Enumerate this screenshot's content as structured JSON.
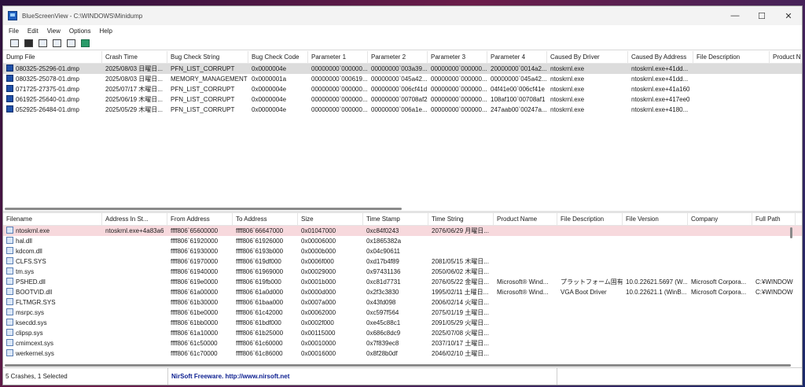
{
  "window": {
    "title": "BlueScreenView  -  C:\\WINDOWS\\Minidump",
    "minimize": "—",
    "maximize": "☐",
    "close": "✕"
  },
  "menu": [
    "File",
    "Edit",
    "View",
    "Options",
    "Help"
  ],
  "toolbar": [
    "properties-icon",
    "save-icon",
    "copy-icon",
    "html-report-icon",
    "find-icon",
    "exit-icon"
  ],
  "top_table": {
    "columns": [
      "Dump File",
      "Crash Time",
      "Bug Check String",
      "Bug Check Code",
      "Parameter 1",
      "Parameter 2",
      "Parameter 3",
      "Parameter 4",
      "Caused By Driver",
      "Caused By Address",
      "File Description",
      "Product N"
    ],
    "sort_indicator": "▽",
    "rows": [
      [
        "080325-25296-01.dmp",
        "2025/08/03 日曜日...",
        "PFN_LIST_CORRUPT",
        "0x0000004e",
        "00000000`000000...",
        "00000000`003a39...",
        "00000000`000000...",
        "20000000`0014a2...",
        "ntoskrnl.exe",
        "ntoskrnl.exe+41dd...",
        "",
        ""
      ],
      [
        "080325-25078-01.dmp",
        "2025/08/03 日曜日...",
        "MEMORY_MANAGEMENT",
        "0x0000001a",
        "00000000`000619...",
        "00000000`045a42...",
        "00000000`000000...",
        "00000000`045a42...",
        "ntoskrnl.exe",
        "ntoskrnl.exe+41dd...",
        "",
        ""
      ],
      [
        "071725-27375-01.dmp",
        "2025/07/17 木曜日...",
        "PFN_LIST_CORRUPT",
        "0x0000004e",
        "00000000`000000...",
        "00000000`006cf41d",
        "00000000`000000...",
        "04f41e00`006cf41e",
        "ntoskrnl.exe",
        "ntoskrnl.exe+41a160",
        "",
        ""
      ],
      [
        "061925-25640-01.dmp",
        "2025/06/19 木曜日...",
        "PFN_LIST_CORRUPT",
        "0x0000004e",
        "00000000`000000...",
        "00000000`00708af2",
        "00000000`000000...",
        "108af100`00708af1",
        "ntoskrnl.exe",
        "ntoskrnl.exe+417ee0",
        "",
        ""
      ],
      [
        "052925-26484-01.dmp",
        "2025/05/29 木曜日...",
        "PFN_LIST_CORRUPT",
        "0x0000004e",
        "00000000`000000...",
        "00000000`006a1e...",
        "00000000`000000...",
        "247aab00`00247a...",
        "ntoskrnl.exe",
        "ntoskrnl.exe+4180...",
        "",
        ""
      ]
    ]
  },
  "bottom_table": {
    "columns": [
      "Filename",
      "Address In St...",
      "From Address",
      "To Address",
      "Size",
      "Time Stamp",
      "Time String",
      "Product Name",
      "File Description",
      "File Version",
      "Company",
      "Full Path"
    ],
    "sort_indicator": "/",
    "rows": [
      [
        "ntoskrnl.exe",
        "ntoskrnl.exe+4a83a6",
        "ffff806`65600000",
        "ffff806`66647000",
        "0x01047000",
        "0xc84f0243",
        "2076/06/29 月曜日...",
        "",
        "",
        "",
        "",
        ""
      ],
      [
        "hal.dll",
        "",
        "ffff806`61920000",
        "ffff806`61926000",
        "0x00006000",
        "0x1865382a",
        "",
        "",
        "",
        "",
        "",
        ""
      ],
      [
        "kdcom.dll",
        "",
        "ffff806`61930000",
        "ffff806`6193b000",
        "0x0000b000",
        "0x04c90611",
        "",
        "",
        "",
        "",
        "",
        ""
      ],
      [
        "CLFS.SYS",
        "",
        "ffff806`61970000",
        "ffff806`619df000",
        "0x0006f000",
        "0xd17b4f89",
        "2081/05/15 木曜日...",
        "",
        "",
        "",
        "",
        ""
      ],
      [
        "tm.sys",
        "",
        "ffff806`61940000",
        "ffff806`61969000",
        "0x00029000",
        "0x97431136",
        "2050/06/02 木曜日...",
        "",
        "",
        "",
        "",
        ""
      ],
      [
        "PSHED.dll",
        "",
        "ffff806`619e0000",
        "ffff806`619fb000",
        "0x0001b000",
        "0xc81d7731",
        "2076/05/22 金曜日...",
        "Microsoft® Wind...",
        "プラットフォーム固有...",
        "10.0.22621.5697 (W...",
        "Microsoft Corpora...",
        "C:¥WINDOW"
      ],
      [
        "BOOTVID.dll",
        "",
        "ffff806`61a00000",
        "ffff806`61a0d000",
        "0x0000d000",
        "0x2f3c3830",
        "1995/02/11 土曜日...",
        "Microsoft® Wind...",
        "VGA Boot Driver",
        "10.0.22621.1 (WinB...",
        "Microsoft Corpora...",
        "C:¥WINDOW"
      ],
      [
        "FLTMGR.SYS",
        "",
        "ffff806`61b30000",
        "ffff806`61baa000",
        "0x0007a000",
        "0x43fd098",
        "2006/02/14 火曜日...",
        "",
        "",
        "",
        "",
        ""
      ],
      [
        "msrpc.sys",
        "",
        "ffff806`61be0000",
        "ffff806`61c42000",
        "0x00062000",
        "0xc597f564",
        "2075/01/19 土曜日...",
        "",
        "",
        "",
        "",
        ""
      ],
      [
        "ksecdd.sys",
        "",
        "ffff806`61bb0000",
        "ffff806`61bdf000",
        "0x0002f000",
        "0xe45c88c1",
        "2091/05/29 火曜日...",
        "",
        "",
        "",
        "",
        ""
      ],
      [
        "clipsp.sys",
        "",
        "ffff806`61a10000",
        "ffff806`61b25000",
        "0x00115000",
        "0x686c8dc9",
        "2025/07/08 火曜日...",
        "",
        "",
        "",
        "",
        ""
      ],
      [
        "cmimcext.sys",
        "",
        "ffff806`61c50000",
        "ffff806`61c60000",
        "0x00010000",
        "0x7f839ec8",
        "2037/10/17 土曜日...",
        "",
        "",
        "",
        "",
        ""
      ],
      [
        "werkernel.sys",
        "",
        "ffff806`61c70000",
        "ffff806`61c86000",
        "0x00016000",
        "0x8f28b0df",
        "2046/02/10 土曜日...",
        "",
        "",
        "",
        "",
        ""
      ]
    ]
  },
  "status": {
    "left": "5 Crashes, 1 Selected",
    "middle": "NirSoft Freeware.  http://www.nirsoft.net"
  }
}
